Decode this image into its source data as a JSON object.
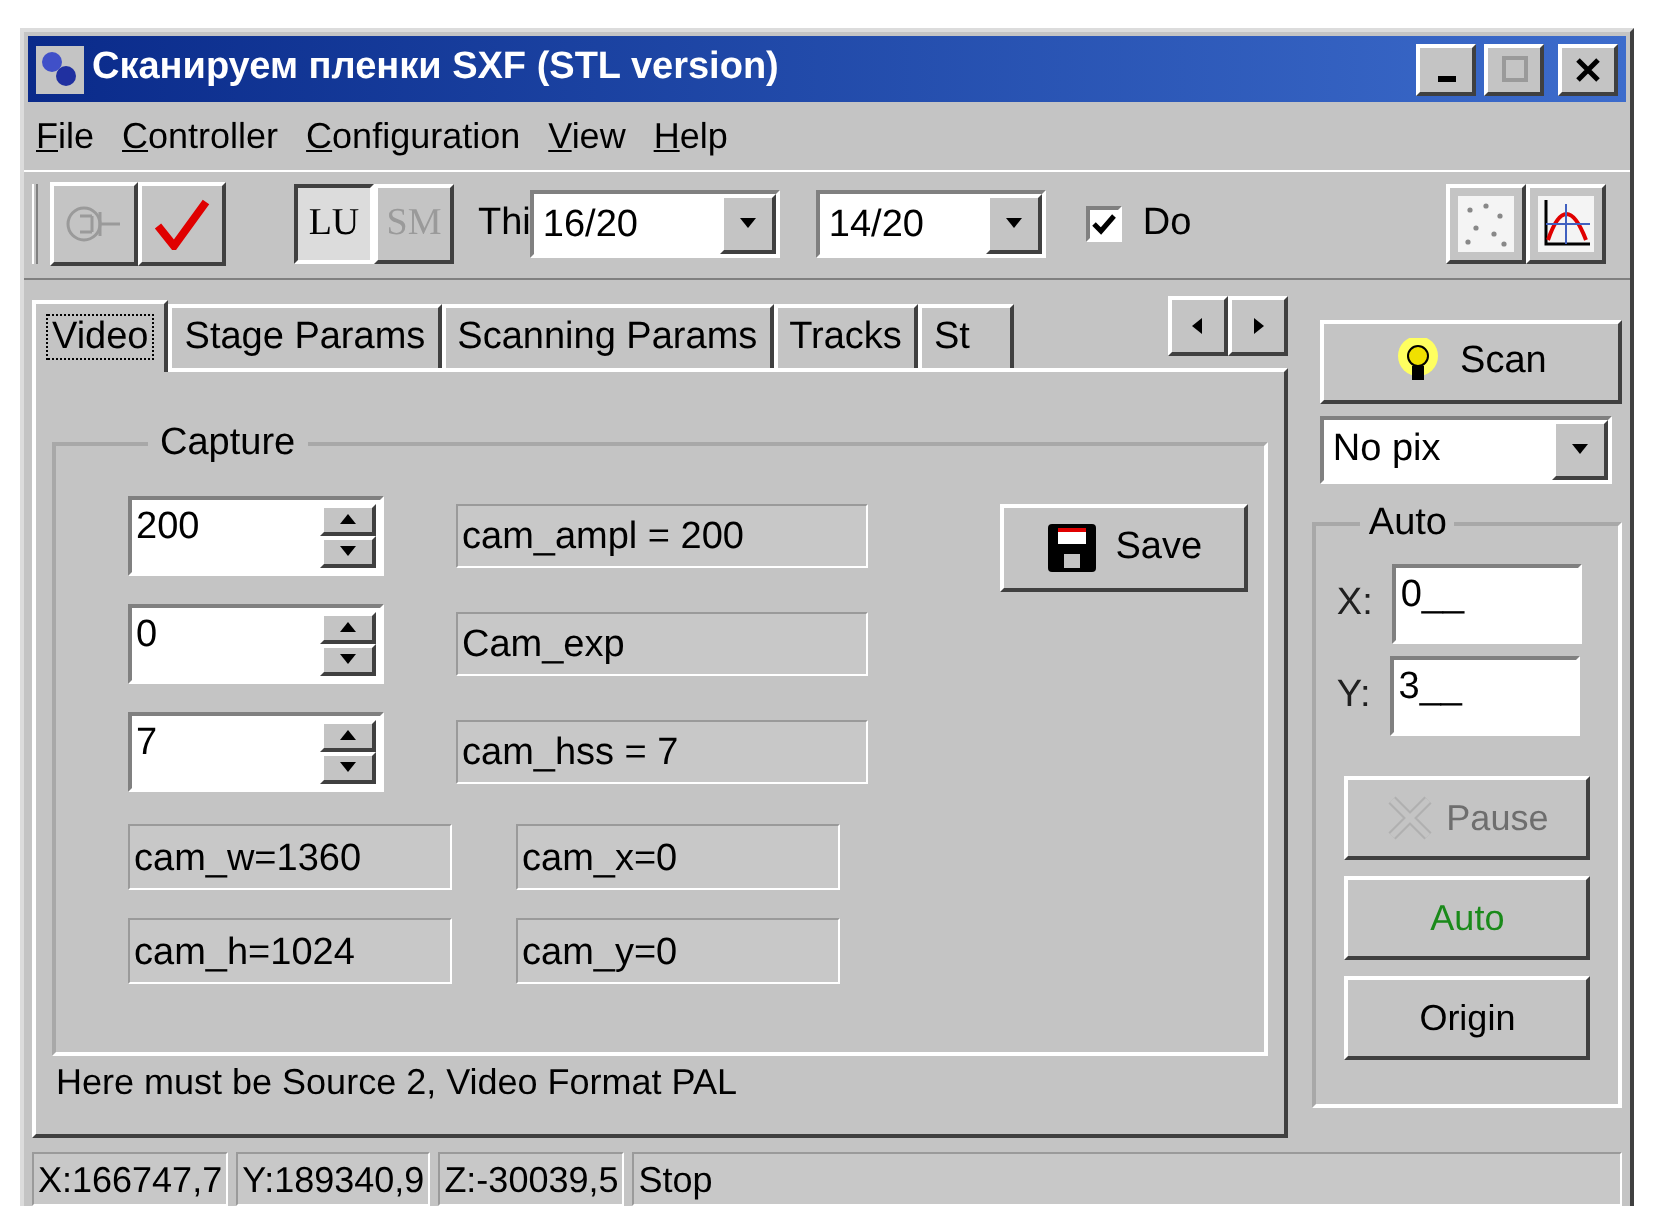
{
  "window": {
    "title": "Сканируем пленки SXF (STL version)"
  },
  "menu": [
    {
      "label": "File"
    },
    {
      "label": "Controller"
    },
    {
      "label": "Configuration"
    },
    {
      "label": "View"
    },
    {
      "label": "Help"
    }
  ],
  "toolbar": {
    "connect_button": {
      "disabled": true
    },
    "apply_button": {
      "disabled": false
    },
    "mode_buttons": [
      {
        "label": "LU",
        "selected": true,
        "disabled": false
      },
      {
        "label": "SM",
        "selected": false,
        "disabled": true
      }
    ],
    "threshold_label": "Thi",
    "combos": [
      {
        "value": "16/20"
      },
      {
        "value": "14/20"
      }
    ],
    "checkbox": {
      "label": "Do",
      "checked": true
    }
  },
  "tabs": [
    {
      "label": "Video",
      "selected": true
    },
    {
      "label": "Stage Params",
      "selected": false
    },
    {
      "label": "Scanning Params",
      "selected": false
    },
    {
      "label": "Tracks",
      "selected": false
    },
    {
      "label": "St",
      "selected": false
    }
  ],
  "capture": {
    "title": "Capture",
    "spinners": [
      {
        "value": "200",
        "readout": "cam_ampl = 200"
      },
      {
        "value": "0",
        "readout": "Cam_exp"
      },
      {
        "value": "7",
        "readout": "cam_hss = 7"
      }
    ],
    "readout_rows": [
      [
        "cam_w=1360",
        "cam_x=0"
      ],
      [
        "cam_h=1024",
        "cam_y=0"
      ]
    ],
    "save_button": "Save"
  },
  "message": "Here must be Source 2, Video Format PAL",
  "side": {
    "scan_button": "Scan",
    "pix_combo": {
      "value": "No pix"
    },
    "auto_group": {
      "title": "Auto",
      "fields": [
        {
          "label": "X:",
          "value": "0__"
        },
        {
          "label": "Y:",
          "value": "3__"
        }
      ]
    },
    "buttons": [
      {
        "label": "Pause",
        "disabled": true,
        "kind": "pause"
      },
      {
        "label": "Auto",
        "disabled": false,
        "kind": "auto"
      },
      {
        "label": "Origin",
        "disabled": false,
        "kind": "plain"
      }
    ]
  },
  "status_bar": [
    "X:166747,7",
    "Y:189340,9",
    "Z:-30039,5",
    "Stop"
  ]
}
